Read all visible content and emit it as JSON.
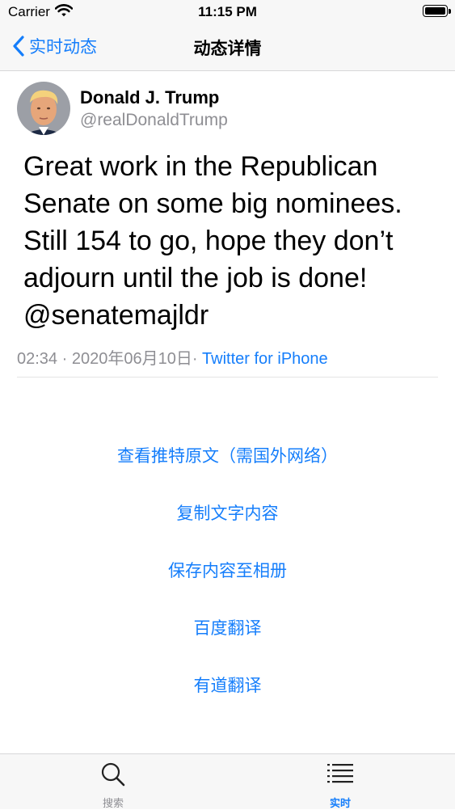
{
  "status_bar": {
    "carrier": "Carrier",
    "time": "11:15 PM"
  },
  "nav": {
    "back_label": "实时动态",
    "title": "动态详情"
  },
  "tweet": {
    "author_name": "Donald J. Trump",
    "author_handle": "@realDonaldTrump",
    "text": "Great work in the Republican Senate on some big nominees. Still 154 to go, hope they don’t adjourn until the job is done! @senatemajldr",
    "time": "02:34",
    "separator": " · ",
    "date": "2020年06月10日",
    "source_separator": "· ",
    "source": "Twitter for iPhone"
  },
  "actions": [
    "查看推特原文（需国外网络）",
    "复制文字内容",
    "保存内容至相册",
    "百度翻译",
    "有道翻译"
  ],
  "tab_bar": {
    "items": [
      {
        "label": "搜索",
        "icon": "search-icon",
        "active": false
      },
      {
        "label": "实时",
        "icon": "list-icon",
        "active": true
      }
    ]
  },
  "colors": {
    "accent": "#157efb",
    "secondary_text": "#8e8e93",
    "bar_background": "#f7f7f7"
  }
}
